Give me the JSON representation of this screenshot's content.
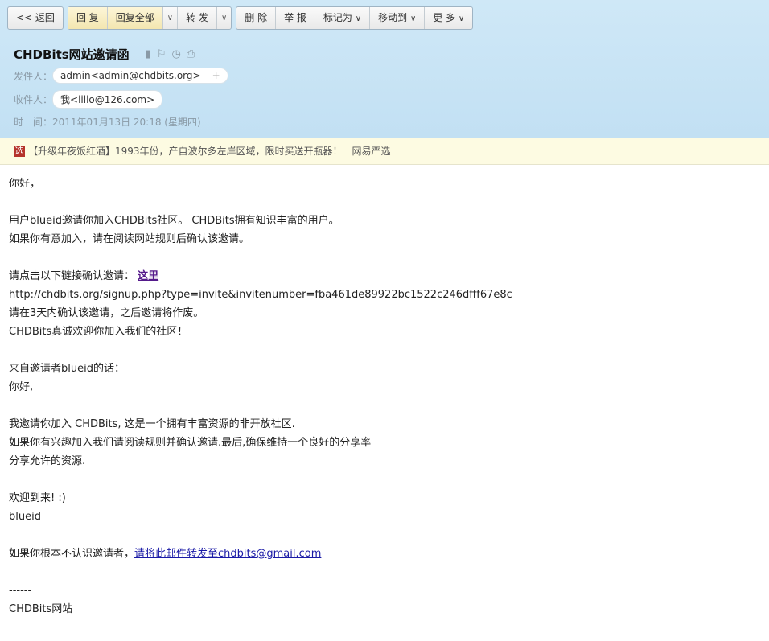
{
  "toolbar": {
    "back": "<< 返回",
    "reply": "回 复",
    "reply_all": "回复全部",
    "forward": "转 发",
    "delete": "删 除",
    "report": "举 报",
    "mark": "标记为",
    "move": "移动到",
    "more": "更 多"
  },
  "header": {
    "subject": "CHDBits网站邀请函",
    "from_label": "发件人：",
    "from": "admin<admin@chdbits.org>",
    "to_label": "收件人：",
    "to": "我<lillo@126.com>",
    "time_label": "时　间：",
    "time": "2011年01月13日 20:18 (星期四)"
  },
  "ad": {
    "icon": "选",
    "text": "【升级年夜饭红酒】1993年份，产自波尔多左岸区域，限时买送开瓶器！",
    "source": "网易严选"
  },
  "body": {
    "l1": "你好，",
    "l2": "用户blueid邀请你加入CHDBits社区。 CHDBits拥有知识丰富的用户。",
    "l3": "如果你有意加入，请在阅读网站规则后确认该邀请。",
    "l4": "请点击以下链接确认邀请：",
    "l4_link": "这里",
    "l5": "http://chdbits.org/signup.php?type=invite&invitenumber=fba461de89922bc1522c246dfff67e8c",
    "l6": "请在3天内确认该邀请，之后邀请将作废。",
    "l7": "CHDBits真诚欢迎你加入我们的社区！",
    "l8": "来自邀请者blueid的话：",
    "l9": "你好,",
    "l10": "我邀请你加入 CHDBits, 这是一个拥有丰富资源的非开放社区.",
    "l11": "如果你有兴趣加入我们请阅读规则并确认邀请.最后,确保维持一个良好的分享率",
    "l12": "分享允许的资源.",
    "l13": "欢迎到来! :)",
    "l14": "blueid",
    "l15": "如果你根本不认识邀请者，",
    "l15_link": "请将此邮件转发至chdbits@gmail.com",
    "l16": "------",
    "l17": "CHDBits网站"
  }
}
